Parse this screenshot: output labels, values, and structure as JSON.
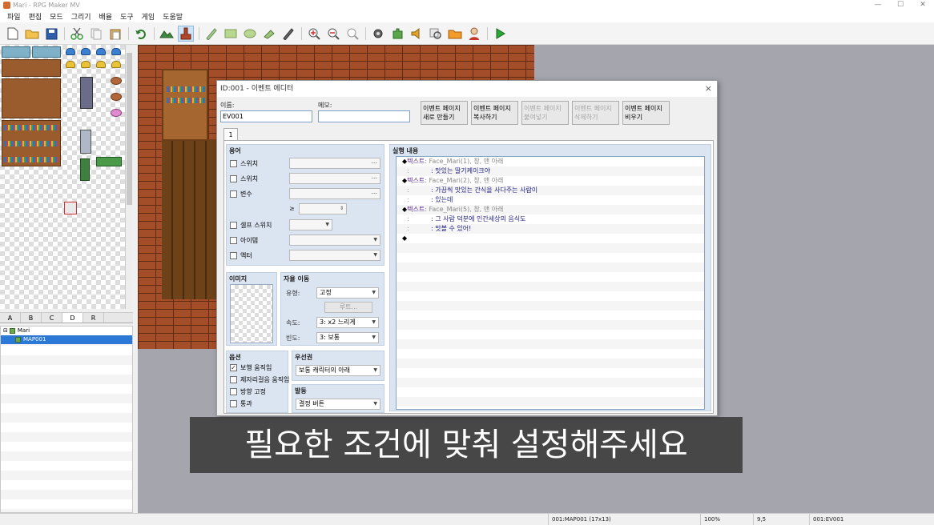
{
  "window": {
    "title": "Mari - RPG Maker MV"
  },
  "menu": [
    "파일",
    "편집",
    "모드",
    "그리기",
    "배율",
    "도구",
    "게임",
    "도움말"
  ],
  "tile_tabs": [
    "A",
    "B",
    "C",
    "D",
    "R"
  ],
  "map_tree": {
    "project": "Mari",
    "map": "MAP001"
  },
  "dialog": {
    "title": "ID:001 - 이벤트 에디터",
    "close": "×",
    "name_label": "이름:",
    "name_value": "EV001",
    "memo_label": "메모:",
    "memo_value": "",
    "page_buttons": [
      {
        "line1": "이벤트 페이지",
        "line2": "새로 만들기"
      },
      {
        "line1": "이벤트 페이지",
        "line2": "복사하기"
      },
      {
        "line1": "이벤트 페이지",
        "line2": "붙여넣기"
      },
      {
        "line1": "이벤트 페이지",
        "line2": "삭제하기"
      },
      {
        "line1": "이벤트 페이지",
        "line2": "비우기"
      }
    ],
    "page_tab": "1",
    "conditions": {
      "title": "용어",
      "switch1": "스위치",
      "switch2": "스위치",
      "variable": "변수",
      "gte": "≥",
      "self_switch": "셀프 스위치",
      "item": "아이템",
      "actor": "액터",
      "dots": "..."
    },
    "image": {
      "title": "이미지"
    },
    "autonomous": {
      "title": "자율 이동",
      "type_label": "유형:",
      "type_value": "고정",
      "route": "루트...",
      "speed_label": "속도:",
      "speed_value": "3: x2 느리게",
      "freq_label": "빈도:",
      "freq_value": "3: 보통"
    },
    "options": {
      "title": "옵션",
      "walking": "보행 움직임",
      "stepping": "제자리걸음 움직임",
      "direction_fix": "방향 고정",
      "through": "통과",
      "walking_check": "✓"
    },
    "priority": {
      "title": "우선권",
      "value": "보통 캐릭터의 아래"
    },
    "trigger": {
      "title": "발동",
      "value": "결정 버튼"
    },
    "contents": {
      "title": "실행 내용",
      "lines": [
        {
          "diamond": "◆",
          "head": "텍스트",
          "args": ": Face_Mari(1), 창, 맨 아래",
          "colon": "",
          "body": ""
        },
        {
          "diamond": "",
          "head": "",
          "args": "",
          "colon": ":",
          "body": ": 맛있는 딸기케이크야"
        },
        {
          "diamond": "◆",
          "head": "텍스트",
          "args": ": Face_Mari(2), 창, 맨 아래",
          "colon": "",
          "body": ""
        },
        {
          "diamond": "",
          "head": "",
          "args": "",
          "colon": ":",
          "body": ": 가끔씩 맛있는 간식을 사다주는 사람이"
        },
        {
          "diamond": "",
          "head": "",
          "args": "",
          "colon": ":",
          "body": ": 있는데"
        },
        {
          "diamond": "◆",
          "head": "텍스트",
          "args": ": Face_Mari(5), 창, 맨 아래",
          "colon": "",
          "body": ""
        },
        {
          "diamond": "",
          "head": "",
          "args": "",
          "colon": ":",
          "body": ": 그 사람 덕분에 인간세상의 음식도"
        },
        {
          "diamond": "",
          "head": "",
          "args": "",
          "colon": ":",
          "body": ": 맛볼 수 있어!"
        },
        {
          "diamond": "◆",
          "head": "",
          "args": "",
          "colon": "",
          "body": ""
        }
      ]
    }
  },
  "subtitle": "필요한 조건에 맞춰 설정해주세요",
  "status": {
    "map": "001:MAP001 (17x13)",
    "zoom": "100%",
    "coords": "9,5",
    "event": "001:EV001"
  },
  "icons": [
    "new-file-icon",
    "open-folder-icon",
    "save-icon",
    "cut-icon",
    "copy-icon",
    "paste-icon",
    "undo-icon",
    "map-mode-icon",
    "event-mode-icon",
    "pencil-icon",
    "rectangle-icon",
    "ellipse-icon",
    "fill-icon",
    "shadow-pen-icon",
    "zoom-in-icon",
    "zoom-out-icon",
    "actual-size-icon",
    "database-icon",
    "plugin-icon",
    "sound-icon",
    "event-search-icon",
    "resource-icon",
    "character-generator-icon",
    "playtest-icon"
  ]
}
